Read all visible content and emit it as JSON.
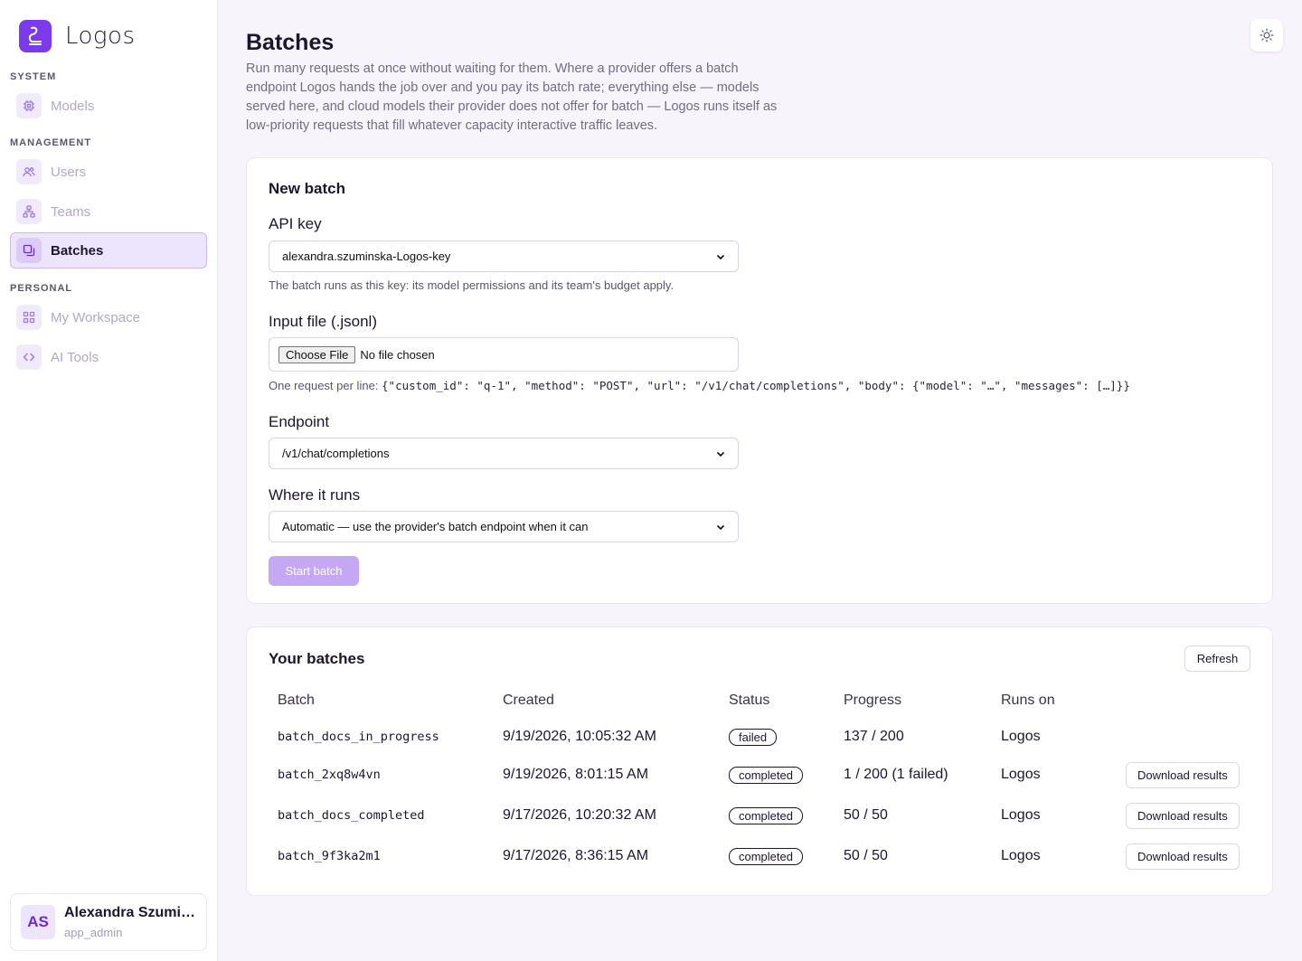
{
  "brand": {
    "name": "Logos"
  },
  "sidebar": {
    "sections": [
      {
        "title": "SYSTEM",
        "items": [
          {
            "label": "Models",
            "icon": "cpu-icon"
          }
        ]
      },
      {
        "title": "MANAGEMENT",
        "items": [
          {
            "label": "Users",
            "icon": "users-icon"
          },
          {
            "label": "Teams",
            "icon": "teams-icon"
          },
          {
            "label": "Batches",
            "icon": "batches-icon",
            "active": true
          }
        ]
      },
      {
        "title": "PERSONAL",
        "items": [
          {
            "label": "My Workspace",
            "icon": "grid-icon"
          },
          {
            "label": "AI Tools",
            "icon": "code-icon"
          }
        ]
      }
    ]
  },
  "user": {
    "initials": "AS",
    "name": "Alexandra Szuminska",
    "role": "app_admin"
  },
  "page": {
    "title": "Batches",
    "description": "Run many requests at once without waiting for them. Where a provider offers a batch endpoint Logos hands the job over and you pay its batch rate; everything else — models served here, and cloud models their provider does not offer for batch — Logos runs itself as low-priority requests that fill whatever capacity interactive traffic leaves."
  },
  "new_batch": {
    "title": "New batch",
    "api_key": {
      "label": "API key",
      "value": "alexandra.szuminska-Logos-key",
      "hint": "The batch runs as this key: its model permissions and its team's budget apply."
    },
    "input_file": {
      "label": "Input file (.jsonl)",
      "button": "Choose File",
      "status": "No file chosen",
      "hint_prefix": "One request per line: ",
      "hint_code": "{\"custom_id\": \"q-1\", \"method\": \"POST\", \"url\": \"/v1/chat/completions\", \"body\": {\"model\": \"…\", \"messages\": […]}}"
    },
    "endpoint": {
      "label": "Endpoint",
      "value": "/v1/chat/completions"
    },
    "where_runs": {
      "label": "Where it runs",
      "value": "Automatic — use the provider's batch endpoint when it can"
    },
    "start_label": "Start batch"
  },
  "batches": {
    "title": "Your batches",
    "refresh_label": "Refresh",
    "columns": {
      "batch": "Batch",
      "created": "Created",
      "status": "Status",
      "progress": "Progress",
      "runs_on": "Runs on"
    },
    "rows": [
      {
        "id": "batch_docs_in_progress",
        "created": "9/19/2026, 10:05:32 AM",
        "status": "failed",
        "progress": "137 / 200",
        "runs_on": "Logos",
        "action": ""
      },
      {
        "id": "batch_2xq8w4vn",
        "created": "9/19/2026, 8:01:15 AM",
        "status": "completed",
        "progress": "1 / 200 (1 failed)",
        "runs_on": "Logos",
        "action": "Download results"
      },
      {
        "id": "batch_docs_completed",
        "created": "9/17/2026, 10:20:32 AM",
        "status": "completed",
        "progress": "50 / 50",
        "runs_on": "Logos",
        "action": "Download results"
      },
      {
        "id": "batch_9f3ka2m1",
        "created": "9/17/2026, 8:36:15 AM",
        "status": "completed",
        "progress": "50 / 50",
        "runs_on": "Logos",
        "action": "Download results"
      }
    ]
  },
  "colors": {
    "accent": "#7c3aed",
    "accent_light": "#ede4fd",
    "background": "#f8f4fc"
  }
}
